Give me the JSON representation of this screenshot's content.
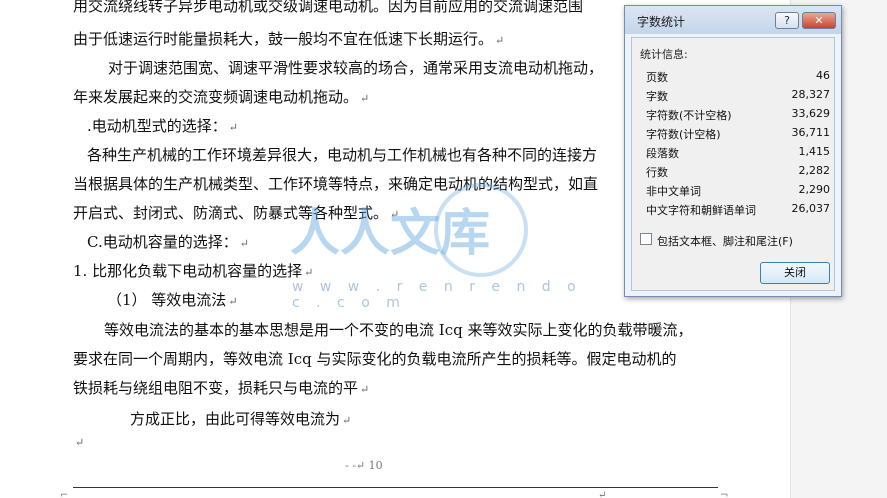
{
  "document": {
    "lines": [
      {
        "text": "用交流绕线转子异步电动机或交级调速电动机。因为目前应用的交流调速范围",
        "mark": ""
      },
      {
        "text": "由于低速运行时能量损耗大，鼓一般均不宜在低速下长期运行。",
        "mark": "↵"
      },
      {
        "text": "对于调速范围宽、调速平滑性要求较高的场合，通常采用支流电动机拖动，",
        "mark": ""
      },
      {
        "text": "年来发展起来的交流变频调速电动机拖动。",
        "mark": "↵"
      },
      {
        "text": ".电动机型式的选择：",
        "mark": "↵"
      },
      {
        "text": "各种生产机械的工作环境差异很大，电动机与工作机械也有各种不同的连接方",
        "mark": ""
      },
      {
        "text": "当根据具体的生产机械类型、工作环境等特点，来确定电动机的结构型式，如直",
        "mark": ""
      },
      {
        "text": "开启式、封闭式、防滴式、防暴式等各种型式。",
        "mark": "↵"
      },
      {
        "text": "C.电动机容量的选择：",
        "mark": "↵"
      },
      {
        "text": "1.  比那化负载下电动机容量的选择",
        "mark": "↵"
      },
      {
        "text": "（1）  等效电流法",
        "mark": "↵"
      },
      {
        "text": "等效电流法的基本的基本思想是用一个不变的电流 Icq 来等效实际上变化的负载带暖流，",
        "mark": ""
      },
      {
        "text": "要求在同一个周期内，等效电流  Icq 与实际变化的负载电流所产生的损耗等。假定电动机的",
        "mark": ""
      },
      {
        "text": "铁损耗与绕组电阻不变，损耗只与电流的平",
        "mark": "↵"
      },
      {
        "text": "方成正比，由此可得等效电流为",
        "mark": "↵"
      },
      {
        "text": "",
        "mark": "↵"
      }
    ],
    "page_number": "10",
    "page_num_prefix": "-  -↵"
  },
  "watermark": {
    "text": "人人文库",
    "url": "w w w . r e n r e n d o c . c o m"
  },
  "dialog": {
    "title": "字数统计",
    "help_label": "?",
    "close_label": "✕",
    "group_label": "统计信息:",
    "stats": [
      {
        "label": "页数",
        "value": "46"
      },
      {
        "label": "字数",
        "value": "28,327"
      },
      {
        "label": "字符数(不计空格)",
        "value": "33,629"
      },
      {
        "label": "字符数(计空格)",
        "value": "36,711"
      },
      {
        "label": "段落数",
        "value": "1,415"
      },
      {
        "label": "行数",
        "value": "2,282"
      },
      {
        "label": "非中文单词",
        "value": "2,290"
      },
      {
        "label": "中文字符和朝鲜语单词",
        "value": "26,037"
      }
    ],
    "checkbox_label": "包括文本框、脚注和尾注(F)",
    "checkbox_checked": false,
    "close_button_label": "关闭"
  }
}
